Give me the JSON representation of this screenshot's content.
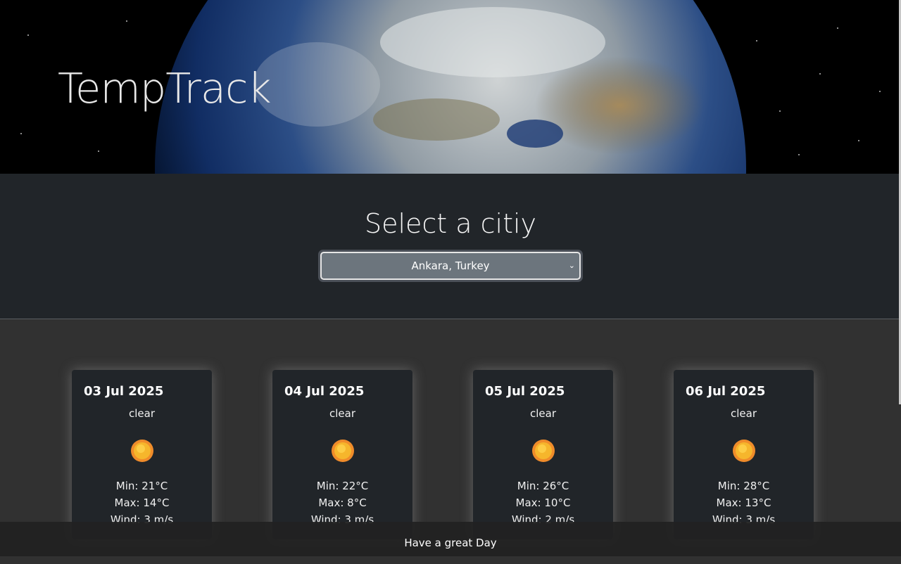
{
  "header": {
    "title": "TempTrack"
  },
  "selector": {
    "title": "Select a citiy",
    "selected_city": "Ankara, Turkey"
  },
  "forecast": [
    {
      "date": "03 Jul 2025",
      "condition": "clear",
      "icon": "sun-icon",
      "min": "Min: 21°C",
      "max": "Max: 14°C",
      "wind": "Wind: 3 m/s"
    },
    {
      "date": "04 Jul 2025",
      "condition": "clear",
      "icon": "sun-icon",
      "min": "Min: 22°C",
      "max": "Max: 8°C",
      "wind": "Wind: 3 m/s"
    },
    {
      "date": "05 Jul 2025",
      "condition": "clear",
      "icon": "sun-icon",
      "min": "Min: 26°C",
      "max": "Max: 10°C",
      "wind": "Wind: 2 m/s"
    },
    {
      "date": "06 Jul 2025",
      "condition": "clear",
      "icon": "sun-icon",
      "min": "Min: 28°C",
      "max": "Max: 13°C",
      "wind": "Wind: 3 m/s"
    }
  ],
  "footer": {
    "text": "Have a great Day"
  },
  "colors": {
    "page_bg": "#313131",
    "band_bg": "#212529",
    "card_bg": "#212529",
    "select_bg": "#6c757d"
  }
}
